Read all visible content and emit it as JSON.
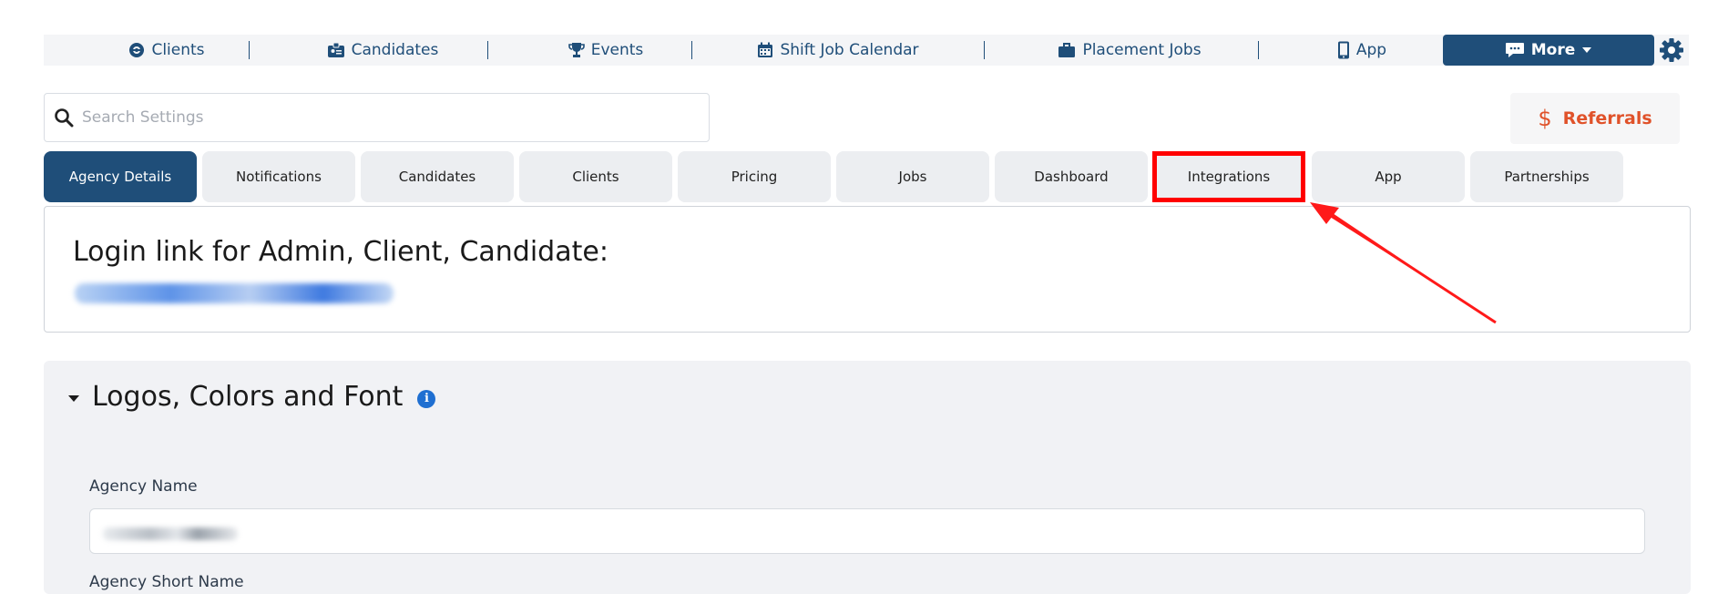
{
  "nav": {
    "items": [
      {
        "label": "Clients",
        "icon": "steering-wheel-icon"
      },
      {
        "label": "Candidates",
        "icon": "id-card-icon"
      },
      {
        "label": "Events",
        "icon": "trophy-icon"
      },
      {
        "label": "Shift Job Calendar",
        "icon": "calendar-icon"
      },
      {
        "label": "Placement Jobs",
        "icon": "briefcase-icon"
      },
      {
        "label": "App",
        "icon": "mobile-icon"
      }
    ],
    "more_label": "More"
  },
  "search": {
    "placeholder": "Search Settings"
  },
  "referrals": {
    "label": "Referrals",
    "symbol": "$"
  },
  "tabs": [
    {
      "label": "Agency Details",
      "active": true
    },
    {
      "label": "Notifications"
    },
    {
      "label": "Candidates"
    },
    {
      "label": "Clients"
    },
    {
      "label": "Pricing"
    },
    {
      "label": "Jobs"
    },
    {
      "label": "Dashboard"
    },
    {
      "label": "Integrations",
      "highlighted": true
    },
    {
      "label": "App"
    },
    {
      "label": "Partnerships"
    }
  ],
  "login_card": {
    "title": "Login link for Admin, Client, Candidate:"
  },
  "section": {
    "title": "Logos, Colors and Font",
    "info_symbol": "i",
    "fields": [
      {
        "label": "Agency Name"
      },
      {
        "label": "Agency Short Name"
      }
    ]
  },
  "colors": {
    "brand": "#1f4e79",
    "referral": "#e0522a",
    "highlight": "#ff0000"
  }
}
